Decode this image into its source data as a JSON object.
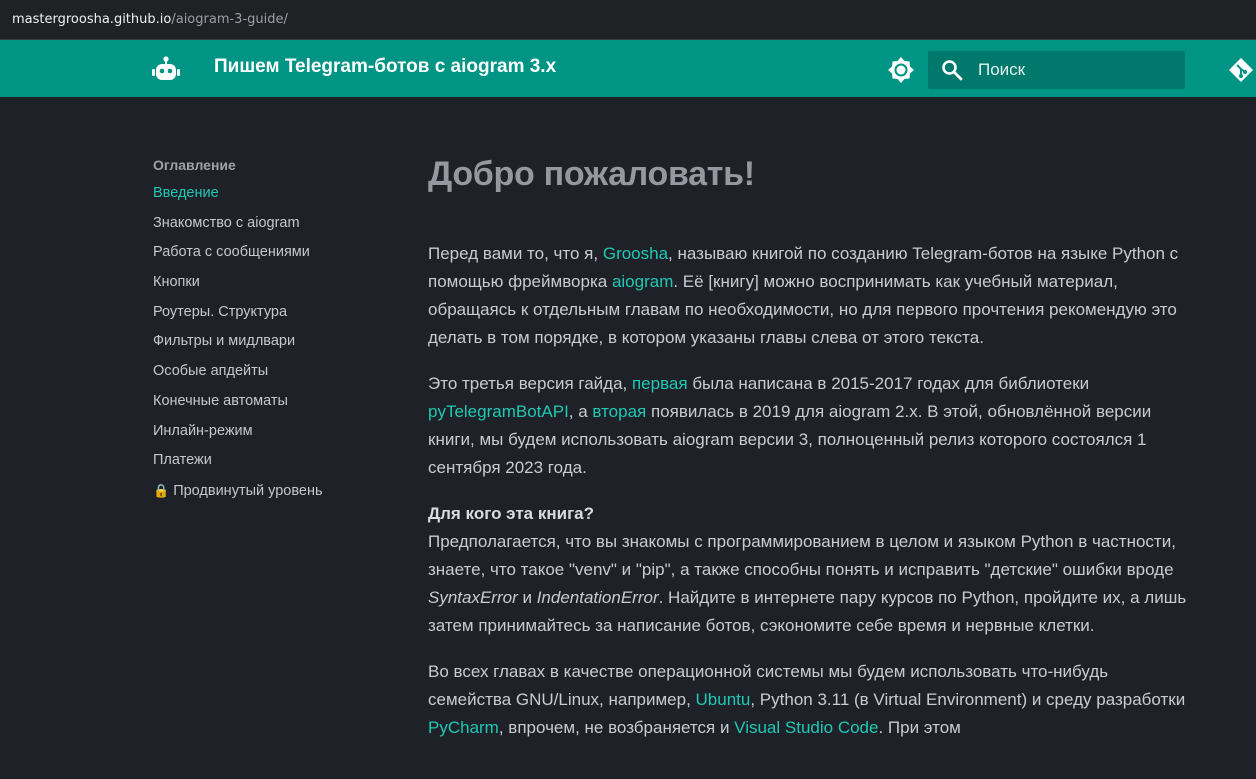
{
  "browser": {
    "url_host": "mastergroosha.github.io",
    "url_path": "/aiogram-3-guide/"
  },
  "header": {
    "title": "Пишем Telegram-ботов с aiogram 3.x",
    "search_placeholder": "Поиск"
  },
  "sidebar": {
    "toc_title": "Оглавление",
    "items": [
      {
        "label": "Введение",
        "active": true
      },
      {
        "label": "Знакомство с aiogram"
      },
      {
        "label": "Работа с сообщениями"
      },
      {
        "label": "Кнопки"
      },
      {
        "label": "Роутеры. Структура"
      },
      {
        "label": "Фильтры и мидлвари"
      },
      {
        "label": "Особые апдейты"
      },
      {
        "label": "Конечные автоматы"
      },
      {
        "label": "Инлайн-режим"
      },
      {
        "label": "Платежи"
      },
      {
        "label": "Продвинутый уровень",
        "icon": "🔒"
      }
    ]
  },
  "article": {
    "title": "Добро пожаловать!",
    "p1": {
      "t1": "Перед вами то, что я, ",
      "link1": "Groosha",
      "t2": ", называю книгой по созданию Telegram-ботов на языке Python с помощью фреймворка ",
      "link2": "aiogram",
      "t3": ". Её [книгу] можно воспринимать как учебный материал, обращаясь к отдельным главам по необходимости, но для первого прочтения рекомендую это делать в том порядке, в котором указаны главы слева от этого текста."
    },
    "p2": {
      "t1": "Это третья версия гайда, ",
      "link1": "первая",
      "t2": " была написана в 2015-2017 годах для библиотеки ",
      "link2": "pyTelegramBotAPI",
      "t3": ", а ",
      "link3": "вторая",
      "t4": " появилась в 2019 для aiogram 2.x. В этой, обновлённой версии книги, мы будем использовать aiogram версии 3, полноценный релиз которого состоялся 1 сентября 2023 года."
    },
    "p3": {
      "heading": "Для кого эта книга?",
      "t1": "Предполагается, что вы знакомы с программированием в целом и языком Python в частности, знаете, что такое \"venv\" и \"pip\", а также способны понять и исправить \"детские\" ошибки вроде ",
      "em1": "SyntaxError",
      "t2": " и ",
      "em2": "IndentationError",
      "t3": ". Найдите в интернете пару курсов по Python, пройдите их, а лишь затем принимайтесь за написание ботов, сэкономите себе время и нервные клетки."
    },
    "p4": {
      "t1": "Во всех главах в качестве операционной системы мы будем использовать что-нибудь семейства GNU/Linux, например, ",
      "link1": "Ubuntu",
      "t2": ", Python 3.11 (в Virtual Environment) и среду разработки ",
      "link2": "PyCharm",
      "t3": ", впрочем, не возбраняется и ",
      "link3": "Visual Studio Code",
      "t4": ". При этом"
    }
  },
  "colors": {
    "header_bg": "#009485",
    "page_bg": "#1f2129",
    "accent": "#1ec9b3"
  },
  "icons": [
    "robot-logo-icon",
    "theme-toggle-icon",
    "search-icon",
    "git-repo-icon",
    "lock-icon"
  ]
}
